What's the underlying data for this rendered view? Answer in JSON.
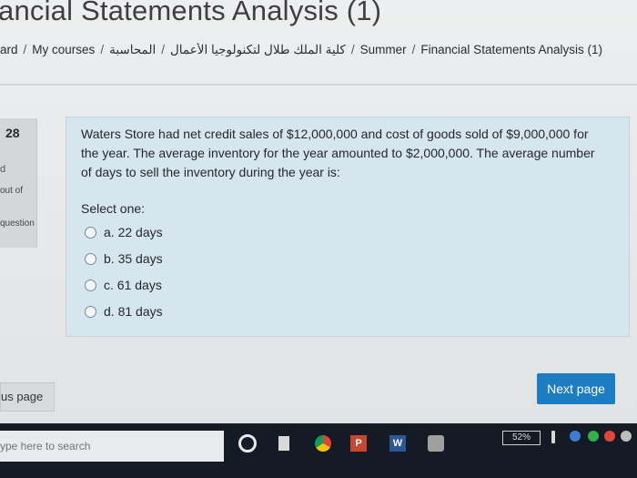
{
  "header": {
    "title": "ancial Statements Analysis (1)",
    "breadcrumb": [
      "ard",
      "My courses",
      "كلية الملك طلال لتكنولوجيا الأعمال",
      "المحاسبة",
      "Summer",
      "Financial Statements Analysis (1)"
    ]
  },
  "question_info": {
    "number": "28",
    "state": "d",
    "mark": "out of",
    "flag": "question"
  },
  "question": {
    "text": "Waters Store had net credit sales of $12,000,000 and cost of goods sold of $9,000,000 for the year. The average inventory for the year amounted to $2,000,000. The average number of days to sell the inventory during the year is:",
    "select_label": "Select one:",
    "options": [
      "a. 22 days",
      "b. 35 days",
      "c. 61 days",
      "d. 81 days"
    ]
  },
  "nav": {
    "previous": "us page",
    "next": "Next page"
  },
  "taskbar": {
    "search_placeholder": "ype here to search",
    "battery": "52%",
    "ppt_letter": "P",
    "word_letter": "W"
  }
}
